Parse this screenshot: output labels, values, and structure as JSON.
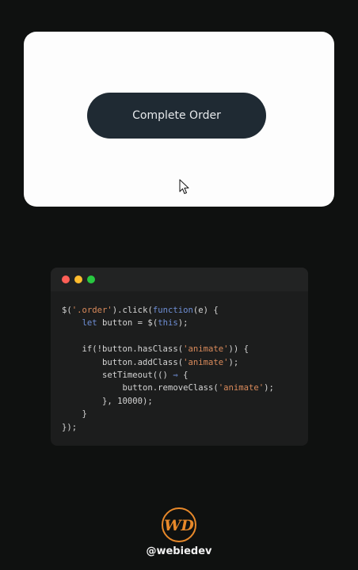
{
  "preview": {
    "button_label": "Complete Order"
  },
  "code_window": {
    "traffic_lights": {
      "close_color": "#ff5f57",
      "minimize_color": "#febc2e",
      "maximize_color": "#28c840"
    },
    "lines": [
      [
        {
          "t": "$(",
          "c": "plain"
        },
        {
          "t": "'.order'",
          "c": "str"
        },
        {
          "t": ").click(",
          "c": "plain"
        },
        {
          "t": "function",
          "c": "kw"
        },
        {
          "t": "(e) {",
          "c": "plain"
        }
      ],
      [
        {
          "t": "    ",
          "c": "plain"
        },
        {
          "t": "let",
          "c": "kw"
        },
        {
          "t": " button = $(",
          "c": "plain"
        },
        {
          "t": "this",
          "c": "kw"
        },
        {
          "t": ");",
          "c": "plain"
        }
      ],
      [],
      [
        {
          "t": "    if(!button.hasClass(",
          "c": "plain"
        },
        {
          "t": "'animate'",
          "c": "str"
        },
        {
          "t": ")) {",
          "c": "plain"
        }
      ],
      [
        {
          "t": "        button.addClass(",
          "c": "plain"
        },
        {
          "t": "'animate'",
          "c": "str"
        },
        {
          "t": ");",
          "c": "plain"
        }
      ],
      [
        {
          "t": "        setTimeout(() ",
          "c": "plain"
        },
        {
          "t": "⇒",
          "c": "arrow"
        },
        {
          "t": " {",
          "c": "plain"
        }
      ],
      [
        {
          "t": "            button.removeClass(",
          "c": "plain"
        },
        {
          "t": "'animate'",
          "c": "str"
        },
        {
          "t": ");",
          "c": "plain"
        }
      ],
      [
        {
          "t": "        }, 10000);",
          "c": "plain"
        }
      ],
      [
        {
          "t": "    }",
          "c": "plain"
        }
      ],
      [
        {
          "t": "});",
          "c": "plain"
        }
      ]
    ]
  },
  "brand": {
    "logo_text": "WD",
    "logo_color": "#e8892a",
    "handle": "@webiedev"
  }
}
